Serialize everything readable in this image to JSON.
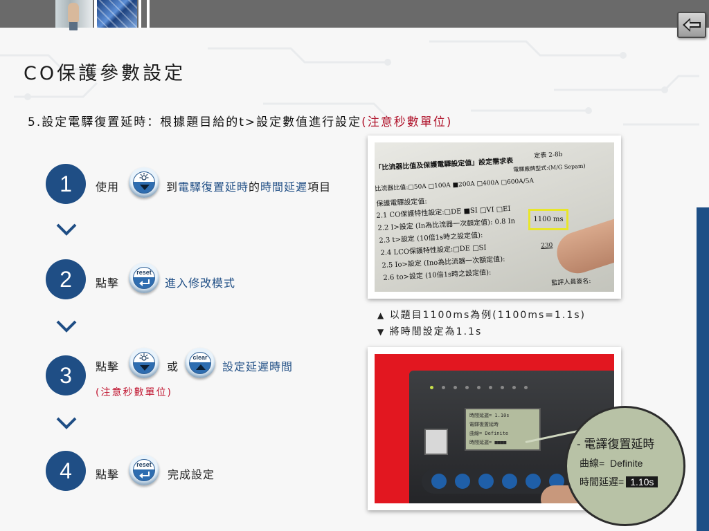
{
  "header": {
    "back_icon": "back-arrow-icon"
  },
  "title": "CO保護參數設定",
  "subtitle": {
    "main": "5.設定電驛復置延時：根據題目給的t>設定數值進行設定",
    "warning": "(注意秒數單位)"
  },
  "steps": [
    {
      "number": "1",
      "prefix": "使用",
      "button": "down-arrow",
      "middle": "到",
      "highlight1": "電驛復置延時",
      "joiner": "的",
      "highlight2": "時間延遲",
      "suffix": "項目"
    },
    {
      "number": "2",
      "prefix": "點擊",
      "button_label": "reset",
      "highlight": "進入修改模式"
    },
    {
      "number": "3",
      "prefix": "點擊",
      "or_text": "或",
      "button2_label": "clear",
      "highlight": "設定延遲時間",
      "note": "(注意秒數單位)"
    },
    {
      "number": "4",
      "prefix": "點擊",
      "button_label": "reset",
      "suffix": "完成設定"
    }
  ],
  "caption": {
    "line1": "以題目1100ms為例(1100ms=1.1s)",
    "line2": "將時間設定為1.1s"
  },
  "doc_photo": {
    "lines": [
      "定表 2-8b",
      "「比流器比值及保護電驛設定值」設定需求表",
      "電驛廠牌型式:(M/G Sepam)",
      "比流器比值:□50A □100A ■200A □400A □600A/5A",
      "保護電驛設定值:",
      "2.1  CO保護特性設定:□DE ■SI □VI □EI",
      "2.2  I>設定 (In為比流器一次額定值):  0.8  In",
      "2.3  t>設定 (10倍1s時之設定值):",
      "2.4  LCO保護特性設定:□DE □SI",
      "2.5  Io>設定 (Ino為比流器一次額定值):",
      "2.6  to>設定 (10倍1s時之設定值):",
      "監評人員簽名:"
    ],
    "highlight_value": "1100 ms",
    "extra_value": "230"
  },
  "device_zoom": {
    "title": "- 電譯復置延時",
    "curve_label": "曲線=",
    "curve_value": "Definite",
    "delay_label": "時間延遲=",
    "delay_value": "1.10s"
  },
  "device_lcd": {
    "line1": "時間延遲=   1.10s",
    "line2": "電驛復置延時",
    "line3": "曲線= Definite",
    "line4": "時間延遲= ■■■■"
  },
  "colors": {
    "accent_blue": "#1f4e85",
    "warning_red": "#b0142c",
    "highlight_yellow": "#e8e62a"
  }
}
